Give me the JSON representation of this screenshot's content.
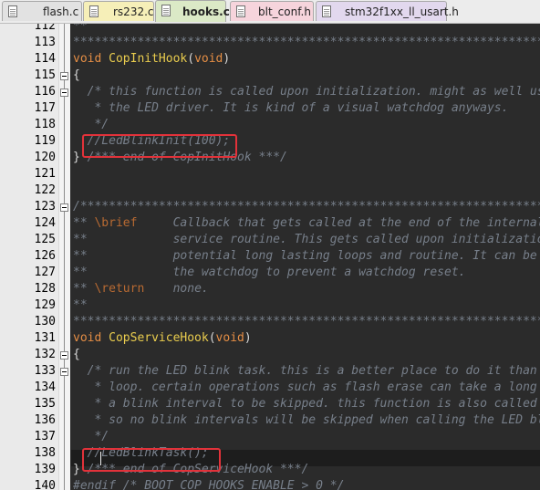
{
  "tabs": [
    {
      "label": "flash.c",
      "active": false
    },
    {
      "label": "rs232.c",
      "active": false
    },
    {
      "label": "hooks.c",
      "active": true
    },
    {
      "label": "blt_conf.h",
      "active": false
    },
    {
      "label": "stm32f1xx_ll_usart.h",
      "active": false
    }
  ],
  "lines": [
    {
      "num": "112",
      "fold": false,
      "segs": [
        {
          "c": "c",
          "t": "**"
        }
      ]
    },
    {
      "num": "113",
      "fold": false,
      "segs": [
        {
          "c": "c",
          "t": "**********************************************************************************"
        }
      ]
    },
    {
      "num": "114",
      "fold": false,
      "segs": [
        {
          "c": "k",
          "t": "void"
        },
        {
          "c": "p",
          "t": " "
        },
        {
          "c": "f",
          "t": "CopInitHook"
        },
        {
          "c": "p",
          "t": "("
        },
        {
          "c": "k",
          "t": "void"
        },
        {
          "c": "p",
          "t": ")"
        }
      ]
    },
    {
      "num": "115",
      "fold": true,
      "segs": [
        {
          "c": "p",
          "t": "{"
        }
      ]
    },
    {
      "num": "116",
      "fold": true,
      "segs": [
        {
          "c": "c",
          "t": "  /* this function is called upon initialization. might as well use it to initialize"
        }
      ]
    },
    {
      "num": "117",
      "fold": false,
      "segs": [
        {
          "c": "c",
          "t": "   * the LED driver. It is kind of a visual watchdog anyways."
        }
      ]
    },
    {
      "num": "118",
      "fold": false,
      "segs": [
        {
          "c": "c",
          "t": "   */"
        }
      ]
    },
    {
      "num": "119",
      "fold": false,
      "segs": [
        {
          "c": "c",
          "t": "  //LedBlinkInit(100);"
        }
      ]
    },
    {
      "num": "120",
      "fold": false,
      "segs": [
        {
          "c": "p",
          "t": "} "
        },
        {
          "c": "c",
          "t": "/*** end of CopInitHook ***/"
        }
      ]
    },
    {
      "num": "121",
      "fold": false,
      "segs": []
    },
    {
      "num": "122",
      "fold": false,
      "segs": []
    },
    {
      "num": "123",
      "fold": true,
      "segs": [
        {
          "c": "c",
          "t": "/*********************************************************************************"
        }
      ]
    },
    {
      "num": "124",
      "fold": false,
      "segs": [
        {
          "c": "c",
          "t": "** "
        },
        {
          "c": "doc",
          "t": "\\brief"
        },
        {
          "c": "c",
          "t": "     Callback that gets called at the end of the internal COP driver"
        }
      ]
    },
    {
      "num": "125",
      "fold": false,
      "segs": [
        {
          "c": "c",
          "t": "**            service routine. This gets called upon initialization and during"
        }
      ]
    },
    {
      "num": "126",
      "fold": false,
      "segs": [
        {
          "c": "c",
          "t": "**            potential long lasting loops and routine. It can be used to service"
        }
      ]
    },
    {
      "num": "127",
      "fold": false,
      "segs": [
        {
          "c": "c",
          "t": "**            the watchdog to prevent a watchdog reset."
        }
      ]
    },
    {
      "num": "128",
      "fold": false,
      "segs": [
        {
          "c": "c",
          "t": "** "
        },
        {
          "c": "doc",
          "t": "\\return"
        },
        {
          "c": "c",
          "t": "    none."
        }
      ]
    },
    {
      "num": "129",
      "fold": false,
      "segs": [
        {
          "c": "c",
          "t": "**"
        }
      ]
    },
    {
      "num": "130",
      "fold": false,
      "segs": [
        {
          "c": "c",
          "t": "**********************************************************************************"
        }
      ]
    },
    {
      "num": "131",
      "fold": false,
      "segs": [
        {
          "c": "k",
          "t": "void"
        },
        {
          "c": "p",
          "t": " "
        },
        {
          "c": "f",
          "t": "CopServiceHook"
        },
        {
          "c": "p",
          "t": "("
        },
        {
          "c": "k",
          "t": "void"
        },
        {
          "c": "p",
          "t": ")"
        }
      ]
    },
    {
      "num": "132",
      "fold": true,
      "segs": [
        {
          "c": "p",
          "t": "{"
        }
      ]
    },
    {
      "num": "133",
      "fold": true,
      "segs": [
        {
          "c": "c",
          "t": "  /* run the LED blink task. this is a better place to do it than in the main() program"
        }
      ]
    },
    {
      "num": "134",
      "fold": false,
      "segs": [
        {
          "c": "c",
          "t": "   * loop. certain operations such as flash erase can take a long time, which would cause"
        }
      ]
    },
    {
      "num": "135",
      "fold": false,
      "segs": [
        {
          "c": "c",
          "t": "   * a blink interval to be skipped. this function is also called during such operations,"
        }
      ]
    },
    {
      "num": "136",
      "fold": false,
      "segs": [
        {
          "c": "c",
          "t": "   * so no blink intervals will be skipped when calling the LED blink task here."
        }
      ]
    },
    {
      "num": "137",
      "fold": false,
      "segs": [
        {
          "c": "c",
          "t": "   */"
        }
      ]
    },
    {
      "num": "138",
      "fold": false,
      "segs": [
        {
          "c": "c",
          "t": "  //LedBlinkTask();"
        }
      ]
    },
    {
      "num": "139",
      "fold": false,
      "segs": [
        {
          "c": "p",
          "t": "} "
        },
        {
          "c": "c",
          "t": "/*** end of CopServiceHook ***/"
        }
      ]
    },
    {
      "num": "140",
      "fold": false,
      "segs": [
        {
          "c": "c",
          "t": "#endif /* BOOT_COP_HOOKS_ENABLE > 0 */"
        }
      ]
    }
  ]
}
